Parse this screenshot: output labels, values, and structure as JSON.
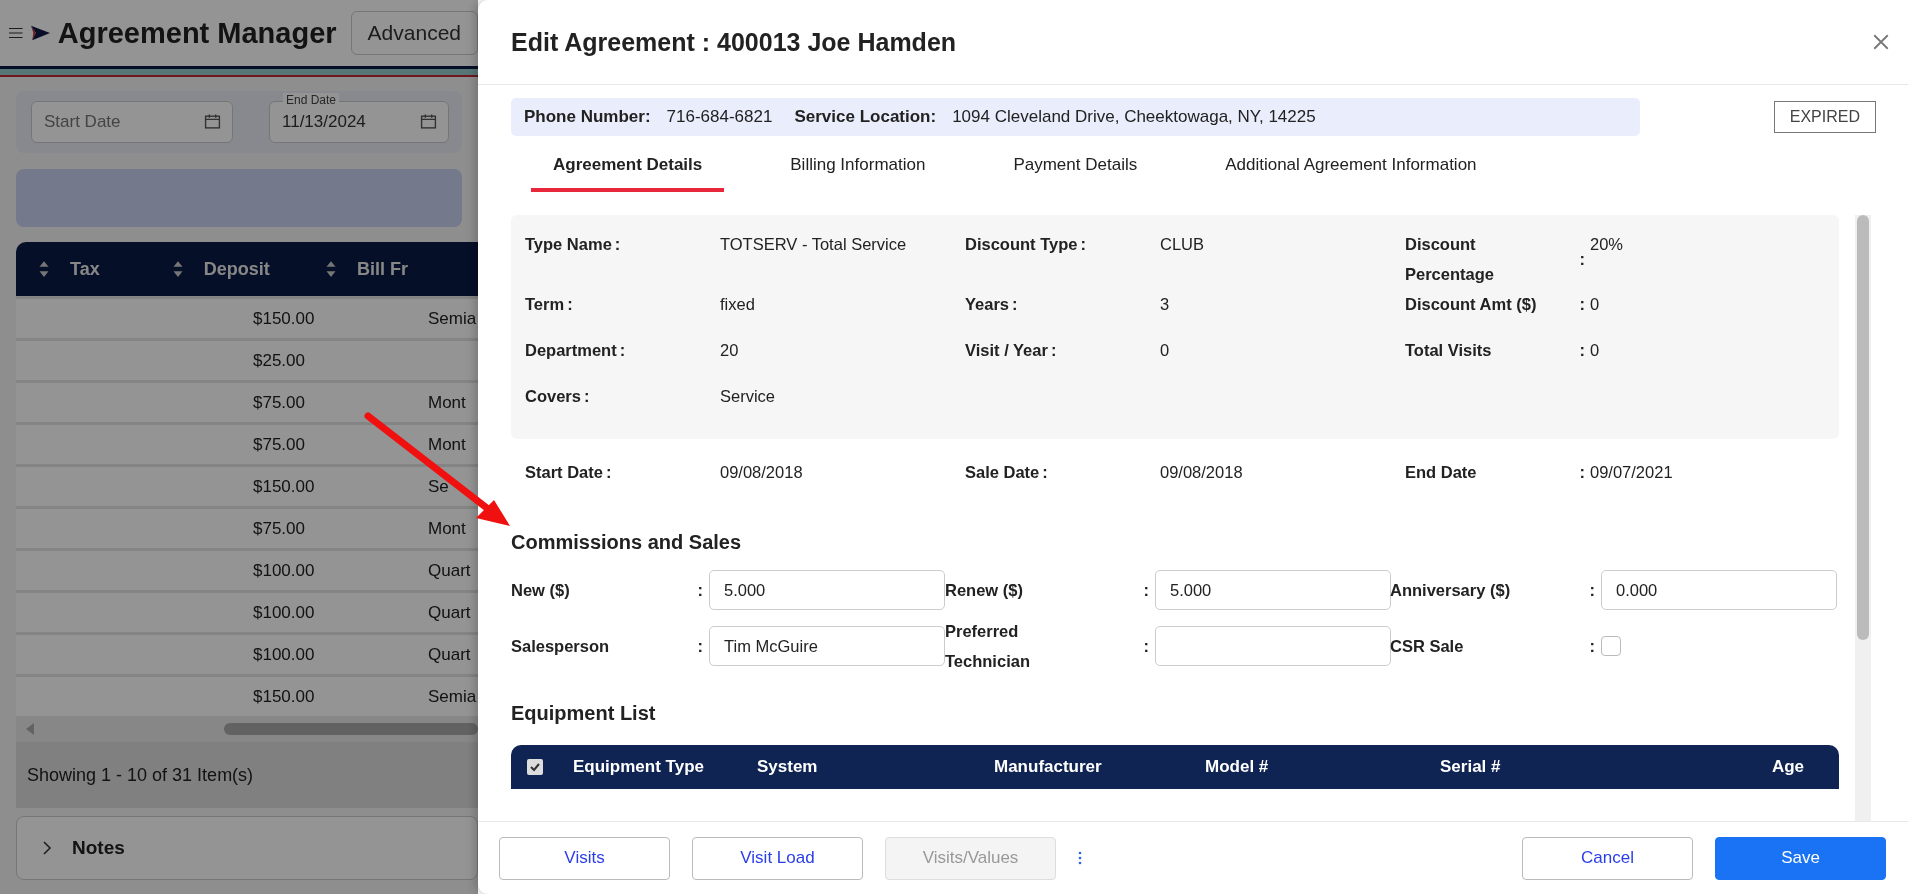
{
  "page": {
    "title": "Agreement Manager",
    "advanced_button": "Advanced",
    "filters": {
      "start_date": {
        "placeholder": "Start Date"
      },
      "end_date": {
        "label": "End Date",
        "value": "11/13/2024"
      }
    },
    "table": {
      "columns": [
        "Tax",
        "Deposit",
        "Bill Fr"
      ],
      "rows": [
        {
          "tax": "",
          "deposit": "$150.00",
          "bill": "Semia"
        },
        {
          "tax": "",
          "deposit": "$25.00",
          "bill": ""
        },
        {
          "tax": "",
          "deposit": "$75.00",
          "bill": "Mont"
        },
        {
          "tax": "",
          "deposit": "$75.00",
          "bill": "Mont"
        },
        {
          "tax": "",
          "deposit": "$150.00",
          "bill": "Se"
        },
        {
          "tax": "",
          "deposit": "$75.00",
          "bill": "Mont"
        },
        {
          "tax": "",
          "deposit": "$100.00",
          "bill": "Quart"
        },
        {
          "tax": "",
          "deposit": "$100.00",
          "bill": "Quart"
        },
        {
          "tax": "",
          "deposit": "$100.00",
          "bill": "Quart"
        },
        {
          "tax": "",
          "deposit": "$150.00",
          "bill": "Semia"
        }
      ]
    },
    "pager": "Showing 1 - 10 of 31 Item(s)",
    "notes": {
      "label": "Notes",
      "expanded": false
    }
  },
  "dialog": {
    "title": "Edit Agreement : 400013 Joe Hamden",
    "info": {
      "phone_label": "Phone Number:",
      "phone": "716-684-6821",
      "location_label": "Service Location:",
      "location": "1094 Cleveland Drive, Cheektowaga, NY, 14225"
    },
    "status": "EXPIRED",
    "tabs": [
      {
        "label": "Agreement Details",
        "selected": true
      },
      {
        "label": "Billing Information",
        "selected": false
      },
      {
        "label": "Payment Details",
        "selected": false
      },
      {
        "label": "Additional Agreement Information",
        "selected": false
      }
    ],
    "details": [
      [
        {
          "label": "Type Name",
          "colon": ":",
          "value": "TOTSERV - Total Service"
        },
        {
          "label": "Discount Type",
          "colon": ":",
          "value": "CLUB"
        },
        {
          "label": "Discount Percentage",
          "colon": ":",
          "value": "20%"
        }
      ],
      [
        {
          "label": "Term",
          "colon": ":",
          "value": "fixed"
        },
        {
          "label": "Years",
          "colon": ":",
          "value": "3"
        },
        {
          "label": "Discount Amt ($)",
          "colon": ":",
          "value": "0"
        }
      ],
      [
        {
          "label": "Department",
          "colon": ":",
          "value": "20"
        },
        {
          "label": "Visit / Year",
          "colon": ":",
          "value": "0"
        },
        {
          "label": "Total Visits",
          "colon": ":",
          "value": "0"
        }
      ],
      [
        {
          "label": "Covers",
          "colon": ":",
          "value": "Service"
        }
      ]
    ],
    "dates": [
      {
        "label": "Start Date",
        "colon": ":",
        "value": "09/08/2018"
      },
      {
        "label": "Sale Date",
        "colon": ":",
        "value": "09/08/2018"
      },
      {
        "label": "End Date",
        "colon": ":",
        "value": "09/07/2021"
      }
    ],
    "commissions": {
      "heading": "Commissions and Sales",
      "fields": [
        {
          "kind": "input",
          "label": "New ($)",
          "colon": ":",
          "value": "5.000"
        },
        {
          "kind": "input",
          "label": "Renew ($)",
          "colon": ":",
          "value": "5.000"
        },
        {
          "kind": "input",
          "label": "Anniversary ($)",
          "colon": ":",
          "value": "0.000"
        },
        {
          "kind": "input",
          "label": "Salesperson",
          "colon": ":",
          "value": "Tim McGuire"
        },
        {
          "kind": "input",
          "label": "Preferred Technician",
          "colon": ":"
        },
        {
          "kind": "checkbox",
          "label": "CSR Sale",
          "colon": ":",
          "checked": false
        }
      ]
    },
    "equipment": {
      "heading": "Equipment List",
      "all_checked": true,
      "columns": [
        "Equipment Type",
        "System",
        "Manufacturer",
        "Model #",
        "Serial #",
        "Age"
      ]
    },
    "footer_left": [
      {
        "label": "Visits",
        "disabled": false
      },
      {
        "label": "Visit Load",
        "disabled": false
      },
      {
        "label": "Visits/Values",
        "disabled": true
      }
    ],
    "footer_right": [
      {
        "label": "Cancel",
        "kind": "secondary"
      },
      {
        "label": "Save",
        "kind": "primary"
      }
    ]
  }
}
